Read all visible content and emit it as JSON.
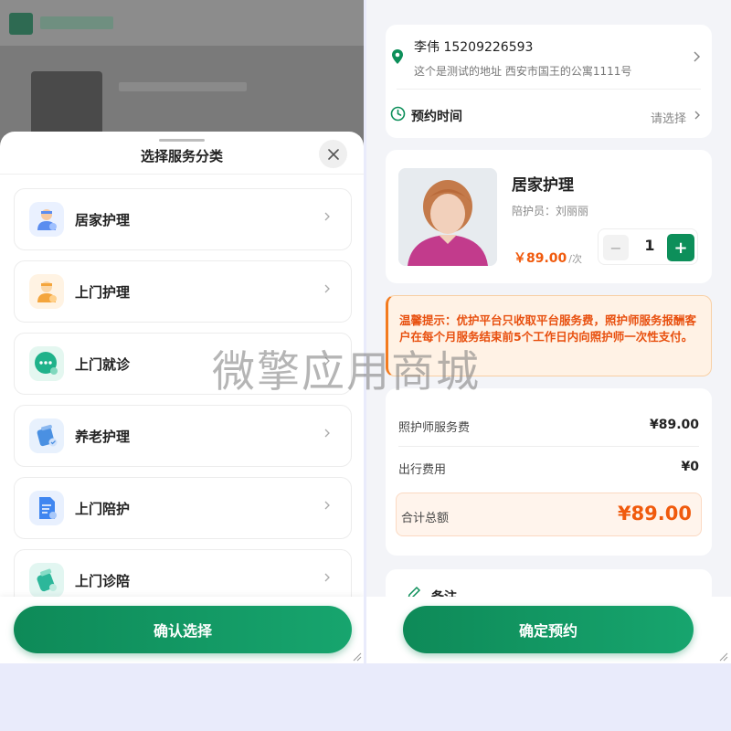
{
  "left_panel": {
    "sheet_title": "选择服务分类",
    "services": [
      {
        "label": "居家护理",
        "icon": "home-care-icon",
        "color": "#5b8def"
      },
      {
        "label": "上门护理",
        "icon": "door-care-icon",
        "color": "#f4a53c"
      },
      {
        "label": "上门就诊",
        "icon": "chat-bubble-icon",
        "color": "#1fb28a"
      },
      {
        "label": "养老护理",
        "icon": "elderly-care-icon",
        "color": "#4a90e2"
      },
      {
        "label": "上门陪护",
        "icon": "document-icon",
        "color": "#3f86f0"
      },
      {
        "label": "上门诊陪",
        "icon": "medicine-icon",
        "color": "#2cb79a"
      }
    ],
    "confirm_label": "确认选择"
  },
  "right_panel": {
    "address": {
      "name_phone": "李伟 15209226593",
      "detail": "这个是测试的地址 西安市国王的公寓1111号"
    },
    "appointment": {
      "label": "预约时间",
      "value": "请选择"
    },
    "nurse": {
      "service_name": "居家护理",
      "attendant": "陪护员：刘丽丽",
      "price": "￥89.00",
      "unit": "/次",
      "quantity": "1"
    },
    "notice": "温馨提示：优护平台只收取平台服务费，照护师服务报酬客户在每个月服务结束前5个工作日内向照护师一次性支付。",
    "fees": {
      "service_fee_label": "照护师服务费",
      "service_fee_value": "¥89.00",
      "travel_fee_label": "出行费用",
      "travel_fee_value": "¥0",
      "total_label": "合计总额",
      "total_value": "¥89.00"
    },
    "remark_label": "备注",
    "book_label": "确定预约"
  },
  "watermark": "微擎应用商城",
  "colors": {
    "primary_green": "#0e8a58",
    "price_orange": "#f05a0d",
    "notice_bg": "#fff2e5"
  }
}
